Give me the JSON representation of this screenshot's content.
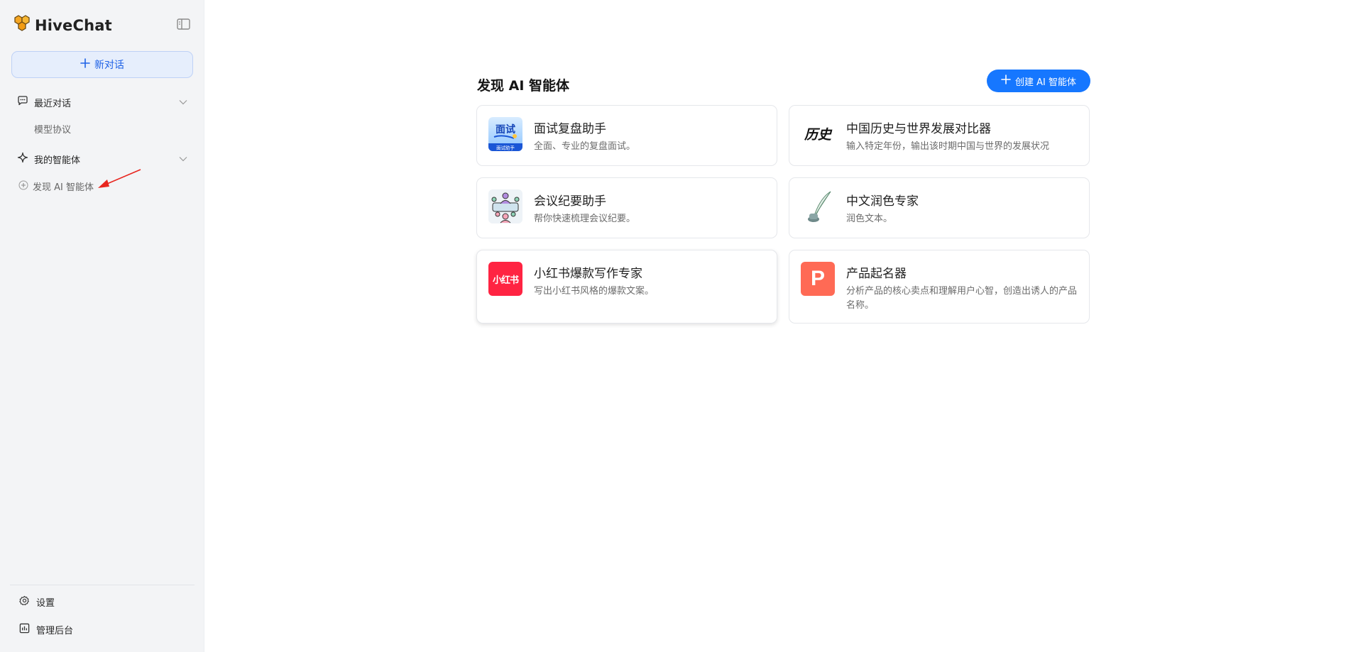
{
  "app": {
    "name": "HiveChat"
  },
  "sidebar": {
    "new_chat_label": "新对话",
    "recent_label": "最近对话",
    "recent_items": [
      {
        "label": "模型协议"
      }
    ],
    "my_agents_label": "我的智能体",
    "discover_label": "发现 AI 智能体",
    "settings_label": "设置",
    "admin_label": "管理后台"
  },
  "main": {
    "title": "发现 AI 智能体",
    "create_button_label": "创建 AI 智能体",
    "agents": [
      {
        "title": "面试复盘助手",
        "description": "全面、专业的复盘面试。",
        "icon": "interview-review-icon",
        "icon_text": "面试",
        "icon_subtext": "面试助手"
      },
      {
        "title": "中国历史与世界发展对比器",
        "description": "输入特定年份，输出该时期中国与世界的发展状况",
        "icon": "history-calligraphy-icon",
        "icon_text": "历史"
      },
      {
        "title": "会议纪要助手",
        "description": "帮你快速梳理会议纪要。",
        "icon": "meeting-people-icon"
      },
      {
        "title": "中文润色专家",
        "description": "润色文本。",
        "icon": "quill-ink-icon"
      },
      {
        "title": "小红书爆款写作专家",
        "description": "写出小红书风格的爆款文案。",
        "icon": "xiaohongshu-logo-icon",
        "icon_text": "小红书"
      },
      {
        "title": "产品起名器",
        "description": "分析产品的核心卖点和理解用户心智，创造出诱人的产品名称。",
        "icon": "letter-p-icon",
        "icon_text": "P"
      }
    ]
  },
  "colors": {
    "accent": "#1677ff",
    "sidebar_bg": "#f3f4f6",
    "new_chat_bg": "#e6eefc",
    "xiaohongshu_red": "#ff2442",
    "product_icon_bg": "#ff6a55"
  }
}
